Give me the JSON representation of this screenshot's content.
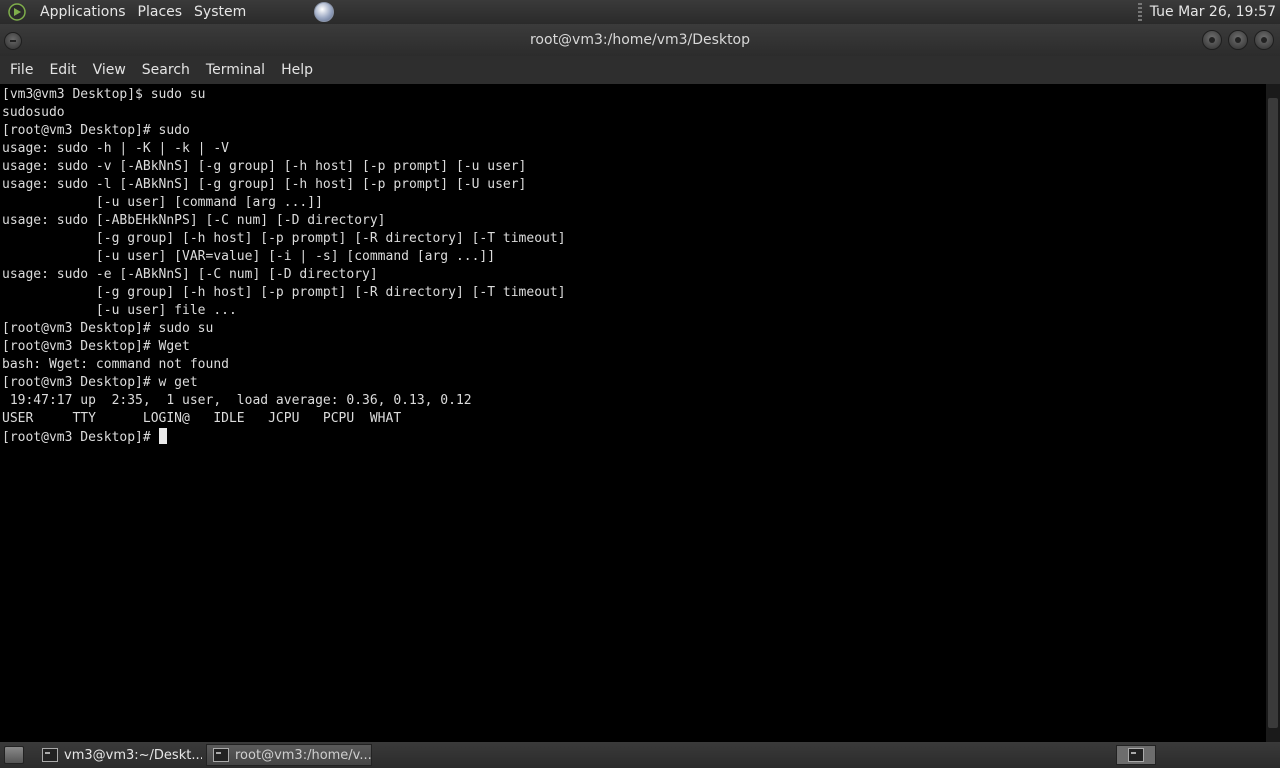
{
  "top_panel": {
    "menus": [
      "Applications",
      "Places",
      "System"
    ],
    "clock": "Tue Mar 26, 19:57"
  },
  "window": {
    "title": "root@vm3:/home/vm3/Desktop"
  },
  "menubar": [
    "File",
    "Edit",
    "View",
    "Search",
    "Terminal",
    "Help"
  ],
  "terminal": {
    "lines": [
      "[vm3@vm3 Desktop]$ sudo su",
      "sudosudo",
      "[root@vm3 Desktop]# sudo",
      "usage: sudo -h | -K | -k | -V",
      "usage: sudo -v [-ABkNnS] [-g group] [-h host] [-p prompt] [-u user]",
      "usage: sudo -l [-ABkNnS] [-g group] [-h host] [-p prompt] [-U user]",
      "            [-u user] [command [arg ...]]",
      "usage: sudo [-ABbEHkNnPS] [-C num] [-D directory]",
      "            [-g group] [-h host] [-p prompt] [-R directory] [-T timeout]",
      "            [-u user] [VAR=value] [-i | -s] [command [arg ...]]",
      "usage: sudo -e [-ABkNnS] [-C num] [-D directory]",
      "            [-g group] [-h host] [-p prompt] [-R directory] [-T timeout]",
      "            [-u user] file ...",
      "[root@vm3 Desktop]# sudo su",
      "[root@vm3 Desktop]# Wget",
      "bash: Wget: command not found",
      "[root@vm3 Desktop]# w get",
      " 19:47:17 up  2:35,  1 user,  load average: 0.36, 0.13, 0.12",
      "USER     TTY      LOGIN@   IDLE   JCPU   PCPU  WHAT"
    ],
    "prompt": "[root@vm3 Desktop]# "
  },
  "taskbar": {
    "tasks": [
      "vm3@vm3:~/Deskt...",
      "root@vm3:/home/v..."
    ]
  },
  "colors": {
    "panel": "#2e2e2e",
    "terminal_bg": "#000000",
    "terminal_fg": "#dcdcdc"
  }
}
